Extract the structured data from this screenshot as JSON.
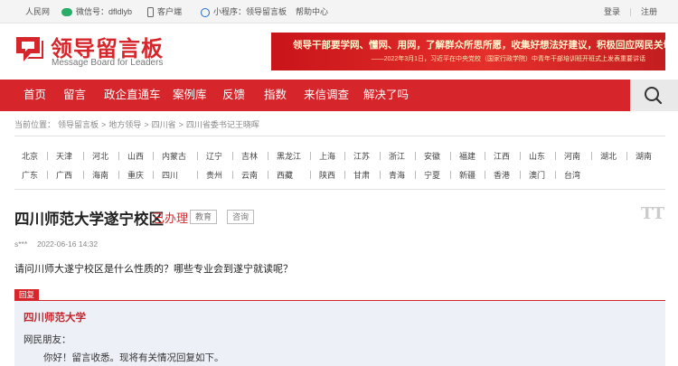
{
  "topbar": {
    "people_net": "人民网",
    "wechat": "微信号：dfldlyb",
    "client": "客户端",
    "mini_program": "小程序：领导留言板",
    "help": "帮助中心",
    "login": "登录",
    "register": "注册"
  },
  "header": {
    "logo_cn": "领导留言板",
    "logo_en": "Message Board for Leaders",
    "banner_line1": "领导干部要学网、懂网、用网，了解群众所思所愿，收集好想法好建议，积极回应网民关切。",
    "banner_line2": "——2022年3月1日，习近平在中央党校（国家行政学院）中青年干部培训班开班式上发表重要讲话"
  },
  "nav": {
    "items": [
      "首页",
      "留言",
      "政企直通车",
      "案例库",
      "反馈",
      "指数",
      "来信调查",
      "解决了吗"
    ]
  },
  "breadcrumb": {
    "label": "当前位置：",
    "items": [
      "领导留言板",
      "地方领导",
      "四川省",
      "四川省委书记王晓晖"
    ],
    "separator": ">"
  },
  "regions": [
    [
      "北京",
      "天津",
      "河北",
      "山西",
      "内蒙古",
      "辽宁",
      "吉林",
      "黑龙江",
      "上海",
      "江苏",
      "浙江",
      "安徽",
      "福建",
      "江西",
      "山东",
      "河南",
      "湖北",
      "湖南"
    ],
    [
      "广东",
      "广西",
      "海南",
      "重庆",
      "四川",
      "贵州",
      "云南",
      "西藏",
      "陕西",
      "甘肃",
      "青海",
      "宁夏",
      "新疆",
      "香港",
      "澳门",
      "台湾"
    ]
  ],
  "message": {
    "title": "四川师范大学遂宁校区",
    "status": "已办理",
    "tags": [
      "教育",
      "咨询"
    ],
    "font_size_icon": "TT",
    "author": "s***",
    "date": "2022-06-16 14:32",
    "content": "请问川师大遂宁校区是什么性质的？哪些专业会到遂宁就读呢？"
  },
  "reply": {
    "tag": "回复",
    "org": "四川师范大学",
    "greeting": "网民朋友：",
    "line1": "你好！留言收悉。现将有关情况回复如下。"
  },
  "colors": {
    "brand_red": "#d7262b",
    "reply_bg": "#eef0f7"
  }
}
